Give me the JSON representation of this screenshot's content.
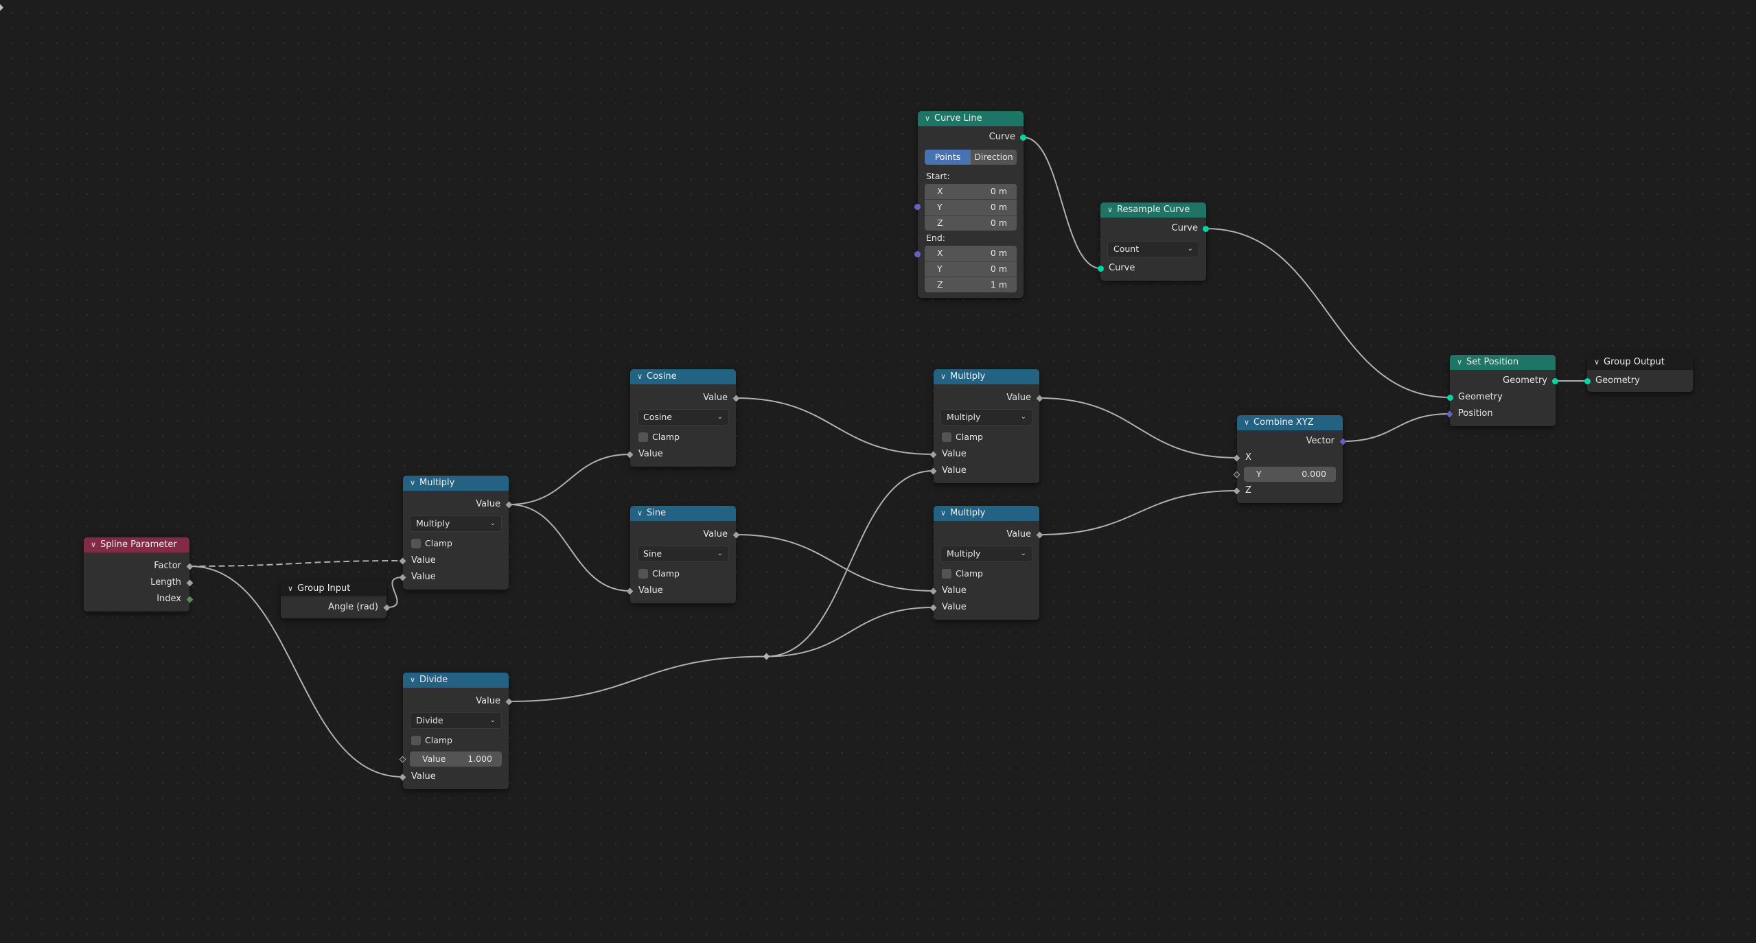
{
  "editor": {
    "type": "Geometry Node Editor",
    "corner_icon": "expand-arrow-icon"
  },
  "colors": {
    "background": "#1d1d1d",
    "node_body": "#303030",
    "header_geometry": "#1e7565",
    "header_converter": "#246283",
    "header_input": "#832a47",
    "header_group": "#1c1c1c",
    "socket_geometry": "#00d6a3",
    "socket_vector": "#6363c7",
    "socket_float": "#a1a1a1",
    "socket_int": "#598c5c",
    "link": "#b0b0b0",
    "segment_active": "#4772b3"
  },
  "nodes": {
    "spline_parameter": {
      "title": "Spline Parameter",
      "outputs": [
        "Factor",
        "Length",
        "Index"
      ]
    },
    "group_input": {
      "title": "Group Input",
      "outputs": [
        "Angle (rad)"
      ]
    },
    "multiply_1": {
      "title": "Multiply",
      "output": "Value",
      "operation": "Multiply",
      "clamp_label": "Clamp",
      "clamp_checked": false,
      "inputs": [
        "Value",
        "Value"
      ]
    },
    "divide": {
      "title": "Divide",
      "output": "Value",
      "operation": "Divide",
      "clamp_label": "Clamp",
      "clamp_checked": false,
      "field_label": "Value",
      "field_value": "1.000",
      "input": "Value"
    },
    "cosine": {
      "title": "Cosine",
      "output": "Value",
      "operation": "Cosine",
      "clamp_label": "Clamp",
      "clamp_checked": false,
      "input": "Value"
    },
    "sine": {
      "title": "Sine",
      "output": "Value",
      "operation": "Sine",
      "clamp_label": "Clamp",
      "clamp_checked": false,
      "input": "Value"
    },
    "multiply_2": {
      "title": "Multiply",
      "output": "Value",
      "operation": "Multiply",
      "clamp_label": "Clamp",
      "clamp_checked": false,
      "inputs": [
        "Value",
        "Value"
      ]
    },
    "multiply_3": {
      "title": "Multiply",
      "output": "Value",
      "operation": "Multiply",
      "clamp_label": "Clamp",
      "clamp_checked": false,
      "inputs": [
        "Value",
        "Value"
      ]
    },
    "curve_line": {
      "title": "Curve Line",
      "output": "Curve",
      "mode_options": [
        "Points",
        "Direction"
      ],
      "mode_selected": "Points",
      "start_label": "Start:",
      "start": [
        {
          "axis": "X",
          "value": "0 m"
        },
        {
          "axis": "Y",
          "value": "0 m"
        },
        {
          "axis": "Z",
          "value": "0 m"
        }
      ],
      "end_label": "End:",
      "end": [
        {
          "axis": "X",
          "value": "0 m"
        },
        {
          "axis": "Y",
          "value": "0 m"
        },
        {
          "axis": "Z",
          "value": "1 m"
        }
      ]
    },
    "resample_curve": {
      "title": "Resample Curve",
      "output": "Curve",
      "mode": "Count",
      "input": "Curve"
    },
    "combine_xyz": {
      "title": "Combine XYZ",
      "output": "Vector",
      "input_x": "X",
      "field_label": "Y",
      "field_value": "0.000",
      "input_z": "Z"
    },
    "set_position": {
      "title": "Set Position",
      "output": "Geometry",
      "inputs": [
        "Geometry",
        "Position"
      ]
    },
    "group_output": {
      "title": "Group Output",
      "inputs": [
        "Geometry"
      ]
    }
  },
  "links": [
    {
      "from": "spline_parameter.Factor",
      "to": "multiply_1.Value[0]",
      "style": "dashed"
    },
    {
      "from": "spline_parameter.Factor",
      "to": "divide.Value[1]",
      "style": "solid"
    },
    {
      "from": "group_input.Angle (rad)",
      "to": "multiply_1.Value[1]",
      "style": "solid"
    },
    {
      "from": "multiply_1.Value",
      "to": "cosine.Value",
      "style": "solid"
    },
    {
      "from": "multiply_1.Value",
      "to": "sine.Value",
      "style": "solid"
    },
    {
      "from": "cosine.Value",
      "to": "multiply_2.Value[0]",
      "style": "solid"
    },
    {
      "from": "sine.Value",
      "to": "multiply_3.Value[0]",
      "style": "solid"
    },
    {
      "from": "divide.Value",
      "to": "reroute",
      "style": "solid"
    },
    {
      "from": "reroute",
      "to": "multiply_2.Value[1]",
      "style": "solid"
    },
    {
      "from": "reroute",
      "to": "multiply_3.Value[1]",
      "style": "solid"
    },
    {
      "from": "multiply_2.Value",
      "to": "combine_xyz.X",
      "style": "solid"
    },
    {
      "from": "multiply_3.Value",
      "to": "combine_xyz.Z",
      "style": "solid"
    },
    {
      "from": "curve_line.Curve",
      "to": "resample_curve.Curve",
      "style": "solid"
    },
    {
      "from": "resample_curve.Curve",
      "to": "set_position.Geometry",
      "style": "solid"
    },
    {
      "from": "combine_xyz.Vector",
      "to": "set_position.Position",
      "style": "solid"
    },
    {
      "from": "set_position.Geometry",
      "to": "group_output.Geometry",
      "style": "solid"
    }
  ]
}
